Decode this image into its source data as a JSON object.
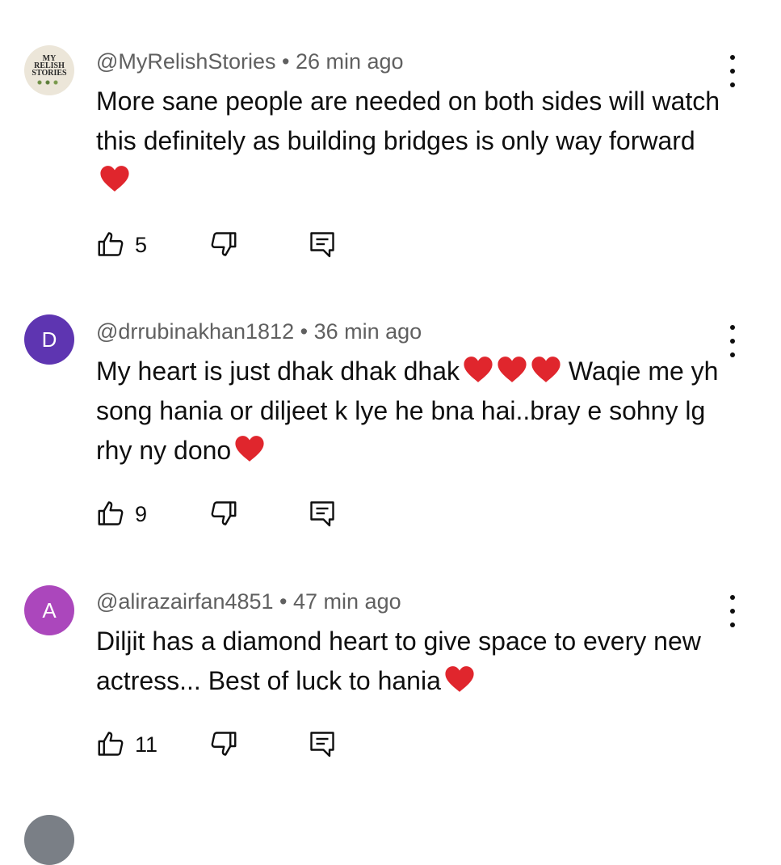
{
  "comments": [
    {
      "author": "@MyRelishStories",
      "time": "26 min ago",
      "avatar": {
        "type": "logo",
        "lines": [
          "MY",
          "RELISH",
          "STORIES"
        ]
      },
      "text": "More sane people are needed on both sides will watch this definitely as building bridges is only way forward",
      "likes": "5"
    },
    {
      "author": "@drrubinakhan1812",
      "time": "36 min ago",
      "avatar": {
        "type": "letter",
        "letter": "D",
        "color": "#5e35b1"
      },
      "text_parts": [
        "My heart is just dhak dhak dhak",
        " Waqie me yh song hania or diljeet k lye he bna hai..bray e sohny lg rhy ny dono"
      ],
      "likes": "9"
    },
    {
      "author": "@alirazairfan4851",
      "time": "47 min ago",
      "avatar": {
        "type": "letter",
        "letter": "A",
        "color": "#ab47bc"
      },
      "text": "Diljit has a diamond heart to give space to every new actress... Best of luck to hania",
      "likes": "11"
    }
  ],
  "separator": " • ",
  "icons": {
    "like": "thumbs-up-icon",
    "dislike": "thumbs-down-icon",
    "reply": "reply-icon",
    "more": "more-vertical-icon",
    "heart": "red-heart-emoji"
  },
  "colors": {
    "heart": "#e0262d",
    "meta": "#606060",
    "text": "#0f0f0f"
  }
}
